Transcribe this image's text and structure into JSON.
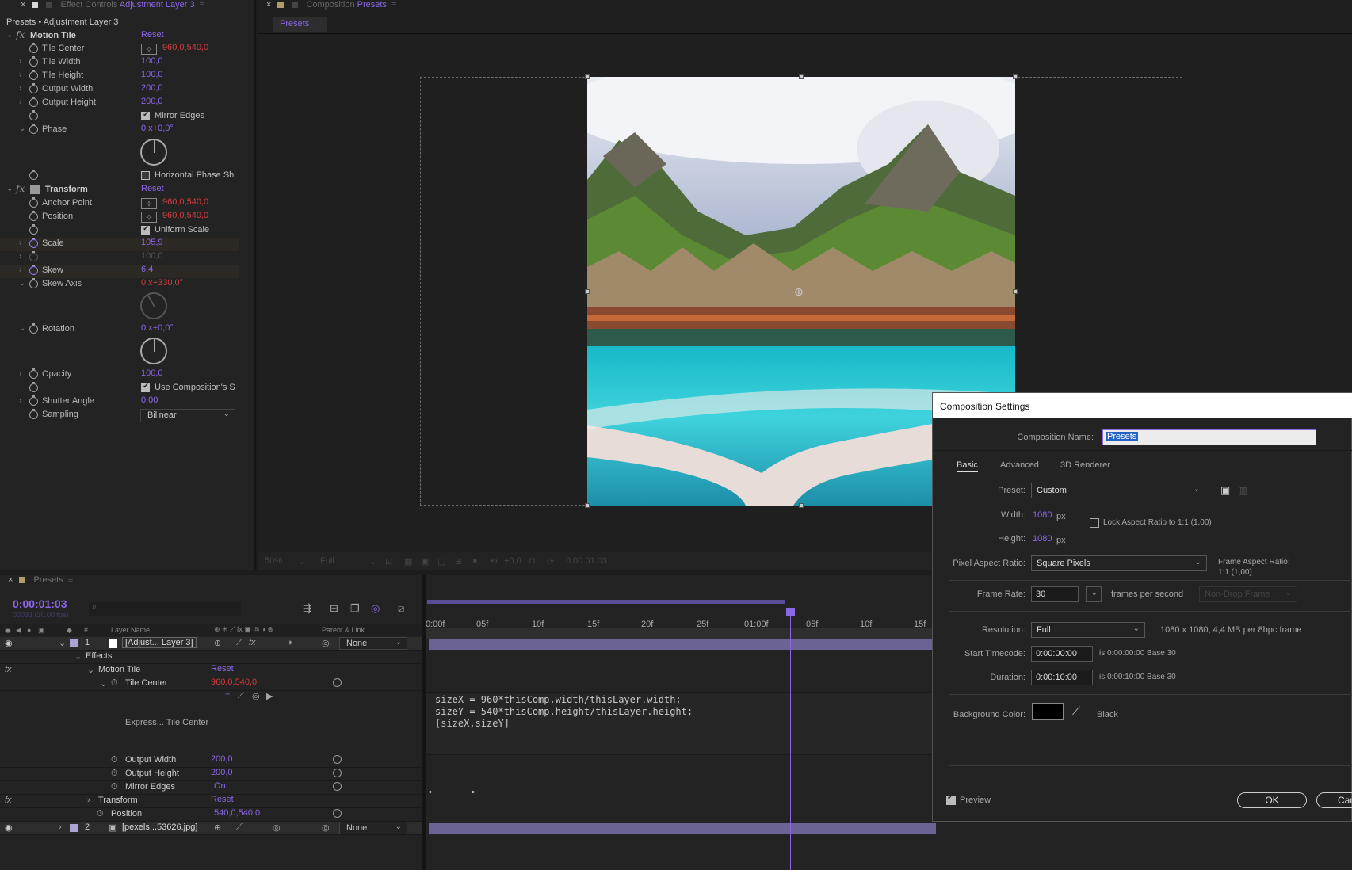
{
  "effect_controls": {
    "tab_label": "Effect Controls",
    "tab_target": "Adjustment Layer 3",
    "header": "Presets • Adjustment Layer 3",
    "motion_tile": {
      "name": "Motion Tile",
      "reset": "Reset",
      "tile_center": {
        "label": "Tile Center",
        "value": "960,0,540,0"
      },
      "tile_width": {
        "label": "Tile Width",
        "value": "100,0"
      },
      "tile_height": {
        "label": "Tile Height",
        "value": "100,0"
      },
      "output_width": {
        "label": "Output Width",
        "value": "200,0"
      },
      "output_height": {
        "label": "Output Height",
        "value": "200,0"
      },
      "mirror_edges": {
        "label": "Mirror Edges",
        "checked": true
      },
      "phase": {
        "label": "Phase",
        "value_prefix": "0 x",
        "value": "+0,0°"
      },
      "horizontal_phase_shift": {
        "label": "Horizontal Phase Shi",
        "checked": false
      }
    },
    "transform": {
      "name": "Transform",
      "reset": "Reset",
      "anchor_point": {
        "label": "Anchor Point",
        "value": "960,0,540,0"
      },
      "position": {
        "label": "Position",
        "value": "960,0,540,0"
      },
      "uniform_scale": {
        "label": "Uniform Scale",
        "checked": true
      },
      "scale": {
        "label": "Scale",
        "value": "105,9"
      },
      "scale_dim": {
        "value": "100,0"
      },
      "skew": {
        "label": "Skew",
        "value": "6,4"
      },
      "skew_axis": {
        "label": "Skew Axis",
        "value_prefix": "0 x",
        "value": "+330,0°"
      },
      "rotation": {
        "label": "Rotation",
        "value_prefix": "0 x",
        "value": "+0,0°"
      },
      "opacity": {
        "label": "Opacity",
        "value": "100,0"
      },
      "use_comp_shutter": {
        "label": "Use Composition's S",
        "checked": true
      },
      "shutter_angle": {
        "label": "Shutter Angle",
        "value": "0,00"
      },
      "sampling": {
        "label": "Sampling",
        "value": "Bilinear"
      }
    }
  },
  "composition": {
    "tab_label": "Composition",
    "tab_target": "Presets",
    "subtab": "Presets",
    "zoom": "50%",
    "resolution": "Full",
    "exposure": "+0,0",
    "timecode": "0:00:01:03"
  },
  "timeline": {
    "tab_label": "Presets",
    "current_time": "0:00:01:03",
    "fps_info": "00033 (30.00 fps)",
    "columns": {
      "layer_name": "Layer Name",
      "parent_link": "Parent & Link",
      "number": "#"
    },
    "ruler_ticks": [
      "0:00f",
      "05f",
      "10f",
      "15f",
      "20f",
      "25f",
      "01:00f",
      "05f",
      "10f",
      "15f"
    ],
    "layers": [
      {
        "number": "1",
        "name": "[Adjust... Layer 3]",
        "parent": "None"
      },
      {
        "number": "2",
        "name": "[pexels...53626.jpg]",
        "parent": "None"
      }
    ],
    "effects_label": "Effects",
    "motion_tile": {
      "name": "Motion Tile",
      "reset": "Reset"
    },
    "tile_center": {
      "label": "Tile Center",
      "value": "960,0,540,0"
    },
    "expression_label": "Express... Tile Center",
    "expression": "sizeX = 960*thisComp.width/thisLayer.width;\nsizeY = 540*thisComp.height/thisLayer.height;\n[sizeX,sizeY]",
    "output_width": {
      "label": "Output Width",
      "value": "200,0"
    },
    "output_height": {
      "label": "Output Height",
      "value": "200,0"
    },
    "mirror_edges": {
      "label": "Mirror Edges",
      "value": "On"
    },
    "transform": {
      "name": "Transform",
      "reset": "Reset"
    },
    "position": {
      "label": "Position",
      "value": "540,0,540,0"
    }
  },
  "dialog": {
    "title": "Composition Settings",
    "name_label": "Composition Name:",
    "name_value": "Presets",
    "tabs": [
      "Basic",
      "Advanced",
      "3D Renderer"
    ],
    "preset_label": "Preset:",
    "preset_value": "Custom",
    "width_label": "Width:",
    "width_value": "1080",
    "height_label": "Height:",
    "height_value": "1080",
    "px": "px",
    "lock_aspect": "Lock Aspect Ratio to 1:1 (1,00)",
    "par_label": "Pixel Aspect Ratio:",
    "par_value": "Square Pixels",
    "frame_aspect_label": "Frame Aspect Ratio:",
    "frame_aspect_value": "1:1 (1,00)",
    "frame_rate_label": "Frame Rate:",
    "frame_rate_value": "30",
    "fps_label": "frames per second",
    "drop_frame": "Non-Drop Frame",
    "resolution_label": "Resolution:",
    "resolution_value": "Full",
    "resolution_info": "1080 x 1080, 4,4 MB per 8bpc frame",
    "start_tc_label": "Start Timecode:",
    "start_tc_value": "0:00:00:00",
    "start_tc_info": "is 0:00:00:00  Base 30",
    "duration_label": "Duration:",
    "duration_value": "0:00:10:00",
    "duration_info": "is 0:00:10:00  Base 30",
    "bg_label": "Background Color:",
    "bg_name": "Black",
    "bg_color": "#000000",
    "preview_label": "Preview",
    "ok": "OK",
    "cancel": "Can"
  },
  "colors": {
    "accent": "#8b67e8",
    "keyframe_value": "#d83a3a"
  }
}
